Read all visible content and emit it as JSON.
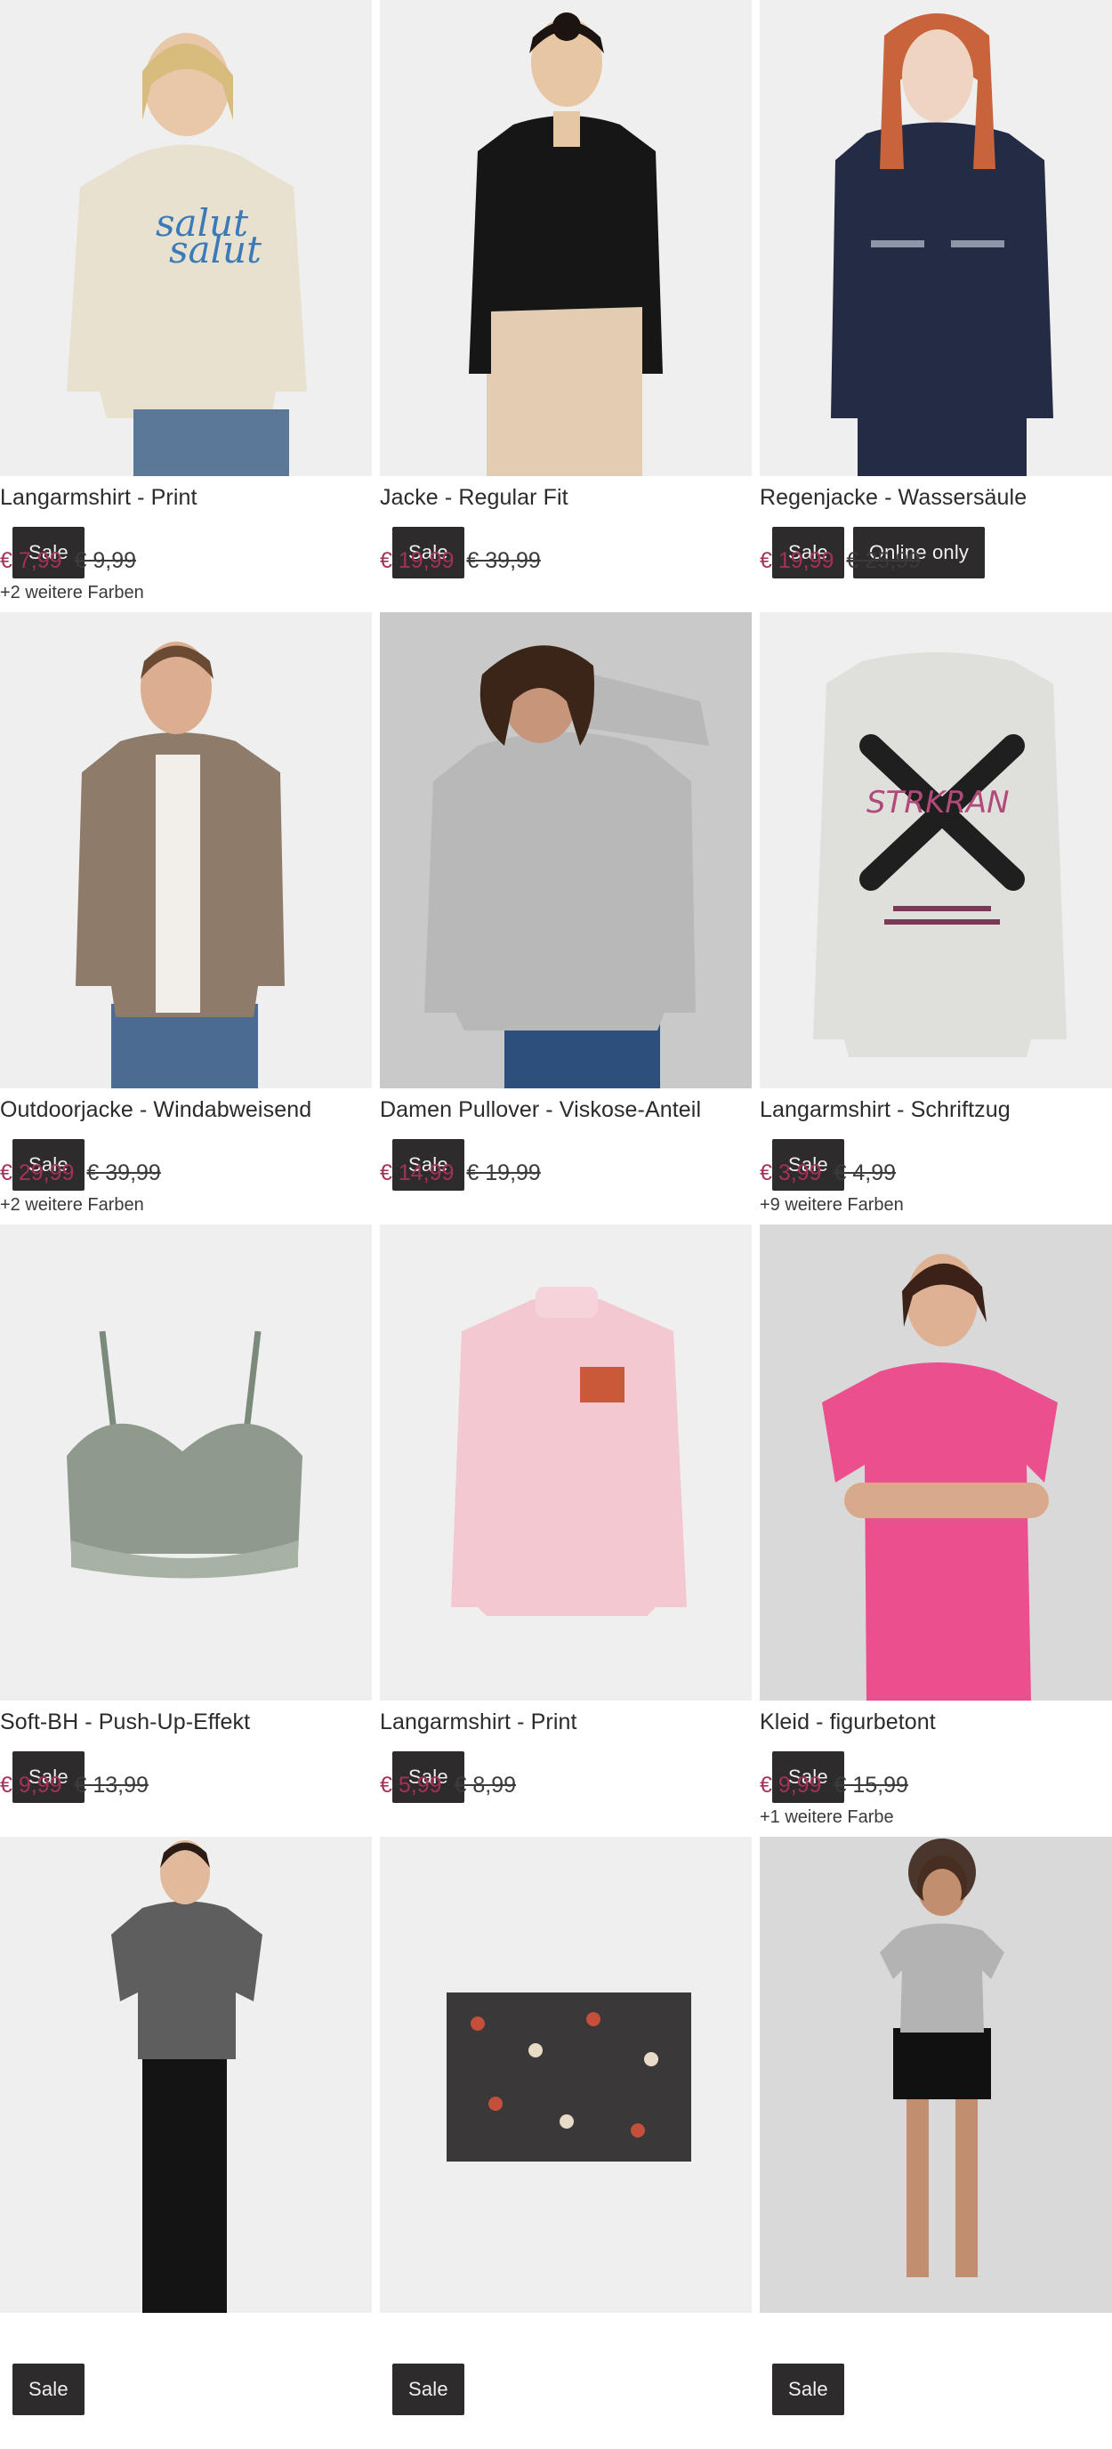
{
  "colors": {
    "sale_price": "#a3315b",
    "badge_bg": "#2d2b2b",
    "badge_text": "#f0efee"
  },
  "products": [
    {
      "name": "Langarmshirt - Print",
      "price": "€ 7,99",
      "old_price": "€ 9,99",
      "colors_note": "+2 weitere Farben",
      "badges": [
        "Sale"
      ],
      "image": "model-beige-longsleeve"
    },
    {
      "name": "Jacke - Regular Fit",
      "price": "€ 19,99",
      "old_price": "€ 39,99",
      "colors_note": "",
      "badges": [
        "Sale"
      ],
      "image": "model-black-jacket"
    },
    {
      "name": "Regenjacke - Wassersäule",
      "price": "€ 19,99",
      "old_price": "€ 25,99",
      "colors_note": "",
      "badges": [
        "Sale",
        "Online only"
      ],
      "image": "model-navy-raincoat"
    },
    {
      "name": "Outdoorjacke - Windabweisend",
      "price": "€ 29,99",
      "old_price": "€ 39,99",
      "colors_note": "+2 weitere Farben",
      "badges": [
        "Sale"
      ],
      "image": "model-brown-bomber"
    },
    {
      "name": "Damen Pullover - Viskose-Anteil",
      "price": "€ 14,99",
      "old_price": "€ 19,99",
      "colors_note": "",
      "badges": [
        "Sale"
      ],
      "image": "model-grey-pullover"
    },
    {
      "name": "Langarmshirt - Schriftzug",
      "price": "€ 3,99",
      "old_price": "€ 4,99",
      "colors_note": "+9 weitere Farben",
      "badges": [
        "Sale"
      ],
      "image": "grey-graphic-shirt"
    },
    {
      "name": "Soft-BH - Push-Up-Effekt",
      "price": "€ 9,99",
      "old_price": "€ 13,99",
      "colors_note": "",
      "badges": [
        "Sale"
      ],
      "image": "green-lace-bra"
    },
    {
      "name": "Langarmshirt - Print",
      "price": "€ 5,99",
      "old_price": "€ 8,99",
      "colors_note": "",
      "badges": [
        "Sale"
      ],
      "image": "pink-turtleneck"
    },
    {
      "name": "Kleid - figurbetont",
      "price": "€ 9,99",
      "old_price": "€ 15,99",
      "colors_note": "+1 weitere Farbe",
      "badges": [
        "Sale"
      ],
      "image": "model-pink-dress"
    },
    {
      "name": "",
      "price": "",
      "old_price": "",
      "colors_note": "",
      "badges": [
        "Sale"
      ],
      "image": "model-grey-tshirt"
    },
    {
      "name": "",
      "price": "",
      "old_price": "",
      "colors_note": "",
      "badges": [
        "Sale"
      ],
      "image": "floral-fabric"
    },
    {
      "name": "",
      "price": "",
      "old_price": "",
      "colors_note": "",
      "badges": [
        "Sale"
      ],
      "image": "model-grey-top-shorts"
    }
  ]
}
